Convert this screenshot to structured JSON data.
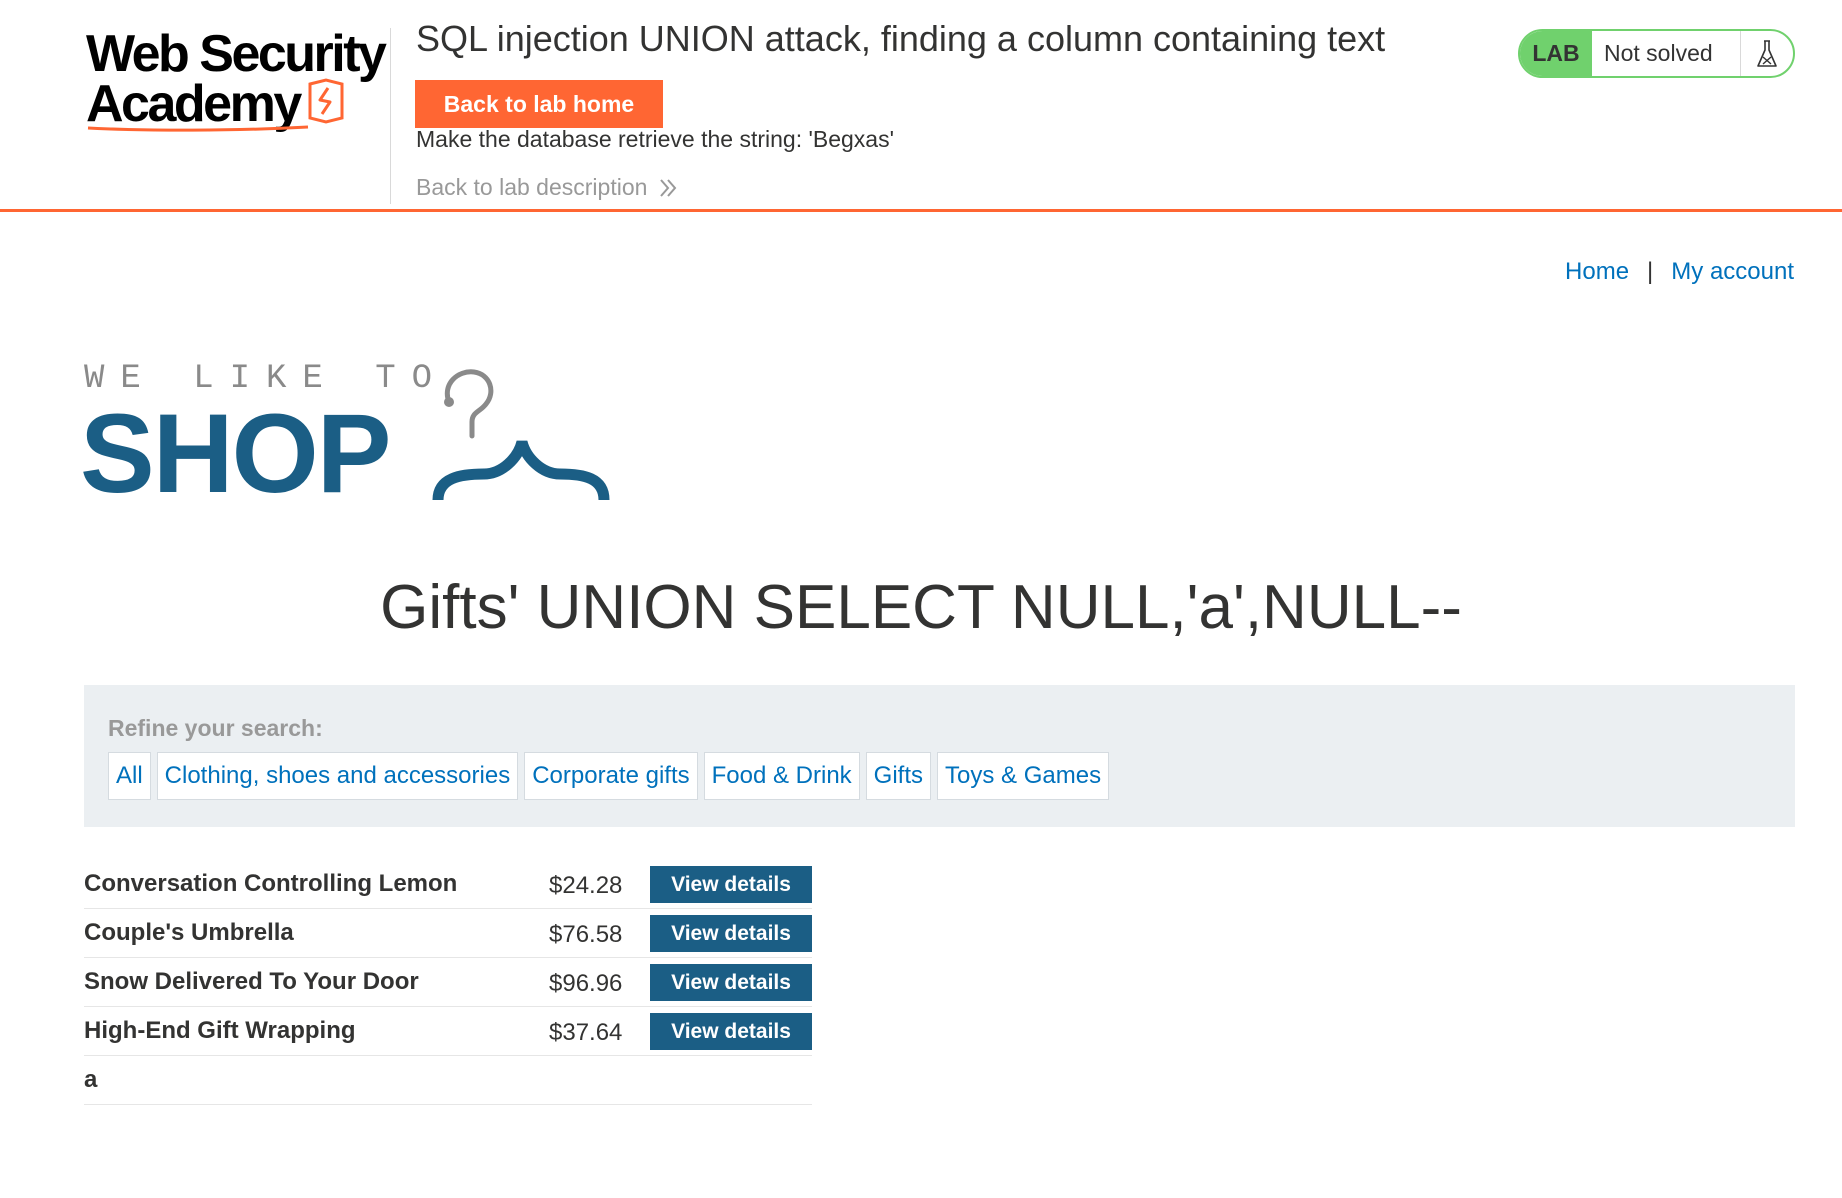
{
  "academy": {
    "logo_line1": "Web Security",
    "logo_line2": "Academy",
    "lab_title": "SQL injection UNION attack, finding a column containing text",
    "back_home_label": "Back to lab home",
    "objective": "Make the database retrieve the string: 'Begxas'",
    "back_description_label": "Back to lab description",
    "status_badge": "LAB",
    "status_text": "Not solved",
    "status_icon": "flask-icon",
    "colors": {
      "accent": "#ff6633",
      "solved_badge": "#70d16d"
    }
  },
  "shop": {
    "nav": {
      "home": "Home",
      "separator": "|",
      "my_account": "My account"
    },
    "logo_tagline": "WE LIKE TO",
    "logo_word": "SHOP",
    "logo_icon": "hanger-icon",
    "heading": "Gifts' UNION SELECT NULL,'a',NULL--",
    "filters": {
      "label": "Refine your search:",
      "categories": [
        "All",
        "Clothing, shoes and accessories",
        "Corporate gifts",
        "Food & Drink",
        "Gifts",
        "Toys & Games"
      ]
    },
    "products": [
      {
        "name": "Conversation Controlling Lemon",
        "price": "$24.28",
        "button": "View details"
      },
      {
        "name": "Couple's Umbrella",
        "price": "$76.58",
        "button": "View details"
      },
      {
        "name": "Snow Delivered To Your Door",
        "price": "$96.96",
        "button": "View details"
      },
      {
        "name": "High-End Gift Wrapping",
        "price": "$37.64",
        "button": "View details"
      },
      {
        "name": "a",
        "price": "",
        "button": ""
      }
    ],
    "colors": {
      "brand": "#1b5e85",
      "link": "#0071bc",
      "filter_bg": "#ebeff2"
    }
  }
}
